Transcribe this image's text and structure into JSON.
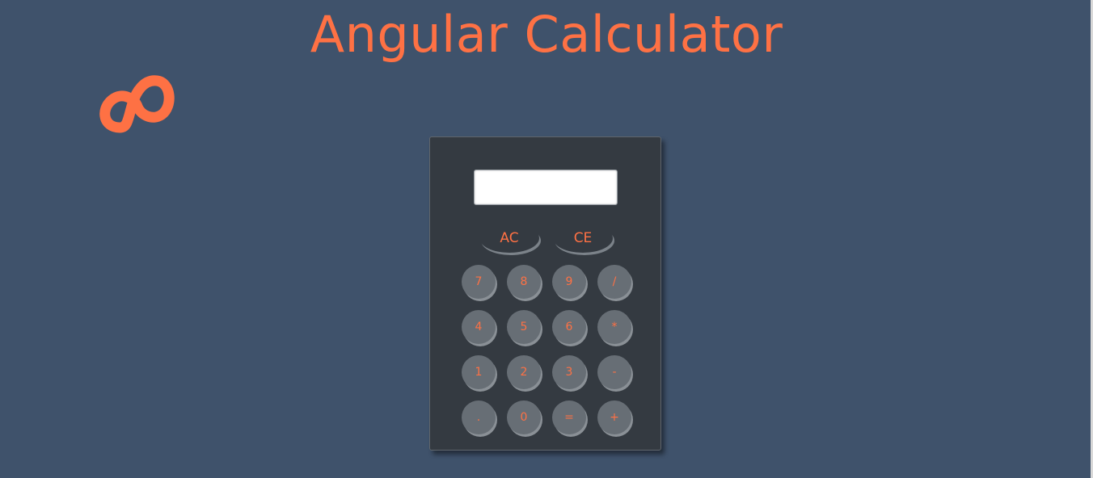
{
  "page": {
    "title": "Angular Calculator",
    "accent_color": "#fe7144",
    "background_color": "#3f526b"
  },
  "logo": {
    "icon": "infinity-loop-icon"
  },
  "calculator": {
    "display_value": "",
    "clear_buttons": [
      {
        "label": "AC"
      },
      {
        "label": "CE"
      }
    ],
    "keys": [
      {
        "label": "7"
      },
      {
        "label": "8"
      },
      {
        "label": "9"
      },
      {
        "label": "/"
      },
      {
        "label": "4"
      },
      {
        "label": "5"
      },
      {
        "label": "6"
      },
      {
        "label": "*"
      },
      {
        "label": "1"
      },
      {
        "label": "2"
      },
      {
        "label": "3"
      },
      {
        "label": "-"
      },
      {
        "label": "."
      },
      {
        "label": "0"
      },
      {
        "label": "="
      },
      {
        "label": "+"
      }
    ]
  }
}
